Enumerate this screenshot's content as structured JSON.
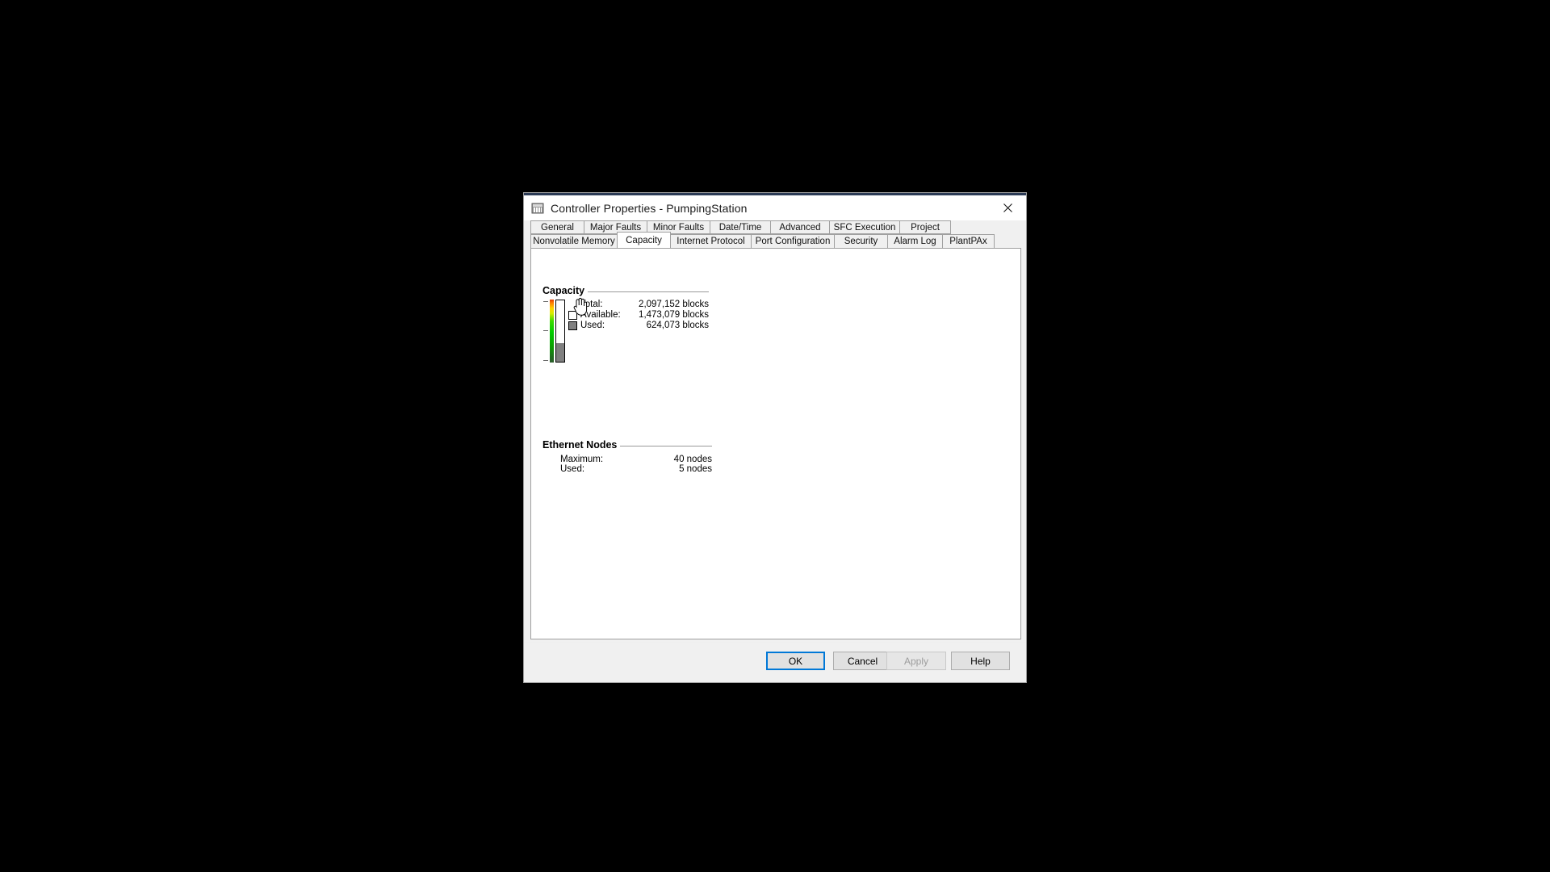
{
  "window": {
    "title": "Controller Properties - PumpingStation",
    "icon": "controller-icon",
    "close_label": "×",
    "accent_color": "#2b3a55"
  },
  "tabs": {
    "row1": [
      {
        "label": "General",
        "selected": false
      },
      {
        "label": "Major Faults",
        "selected": false
      },
      {
        "label": "Minor Faults",
        "selected": false
      },
      {
        "label": "Date/Time",
        "selected": false
      },
      {
        "label": "Advanced",
        "selected": false
      },
      {
        "label": "SFC Execution",
        "selected": false
      },
      {
        "label": "Project",
        "selected": false
      }
    ],
    "row2": [
      {
        "label": "Nonvolatile Memory",
        "selected": false
      },
      {
        "label": "Capacity",
        "selected": true
      },
      {
        "label": "Internet Protocol",
        "selected": false
      },
      {
        "label": "Port Configuration",
        "selected": false
      },
      {
        "label": "Security",
        "selected": false
      },
      {
        "label": "Alarm Log",
        "selected": false
      },
      {
        "label": "PlantPAx",
        "selected": false
      }
    ]
  },
  "capacity": {
    "group_title": "Capacity",
    "rows": [
      {
        "swatch": "none",
        "label": "Total:",
        "value": "2,097,152 blocks"
      },
      {
        "swatch": "white",
        "label": "Available:",
        "value": "1,473,079 blocks"
      },
      {
        "swatch": "gray",
        "label": "Used:",
        "value": "624,073 blocks"
      }
    ],
    "gauge": {
      "used_percent": 29.8,
      "gradient_top_color": "#e03a00",
      "gradient_bottom_color": "#2d5d2d",
      "fill_color": "#808080",
      "empty_color": "#ffffff"
    }
  },
  "ethernet": {
    "group_title": "Ethernet Nodes",
    "rows": [
      {
        "label": "Maximum:",
        "value": "40 nodes"
      },
      {
        "label": "Used:",
        "value": "5 nodes"
      }
    ]
  },
  "footer": {
    "ok": {
      "label": "OK",
      "default": true,
      "disabled": false
    },
    "cancel": {
      "label": "Cancel",
      "default": false,
      "disabled": false
    },
    "apply": {
      "label": "Apply",
      "default": false,
      "disabled": true
    },
    "help": {
      "label": "Help",
      "default": false,
      "disabled": false
    }
  }
}
